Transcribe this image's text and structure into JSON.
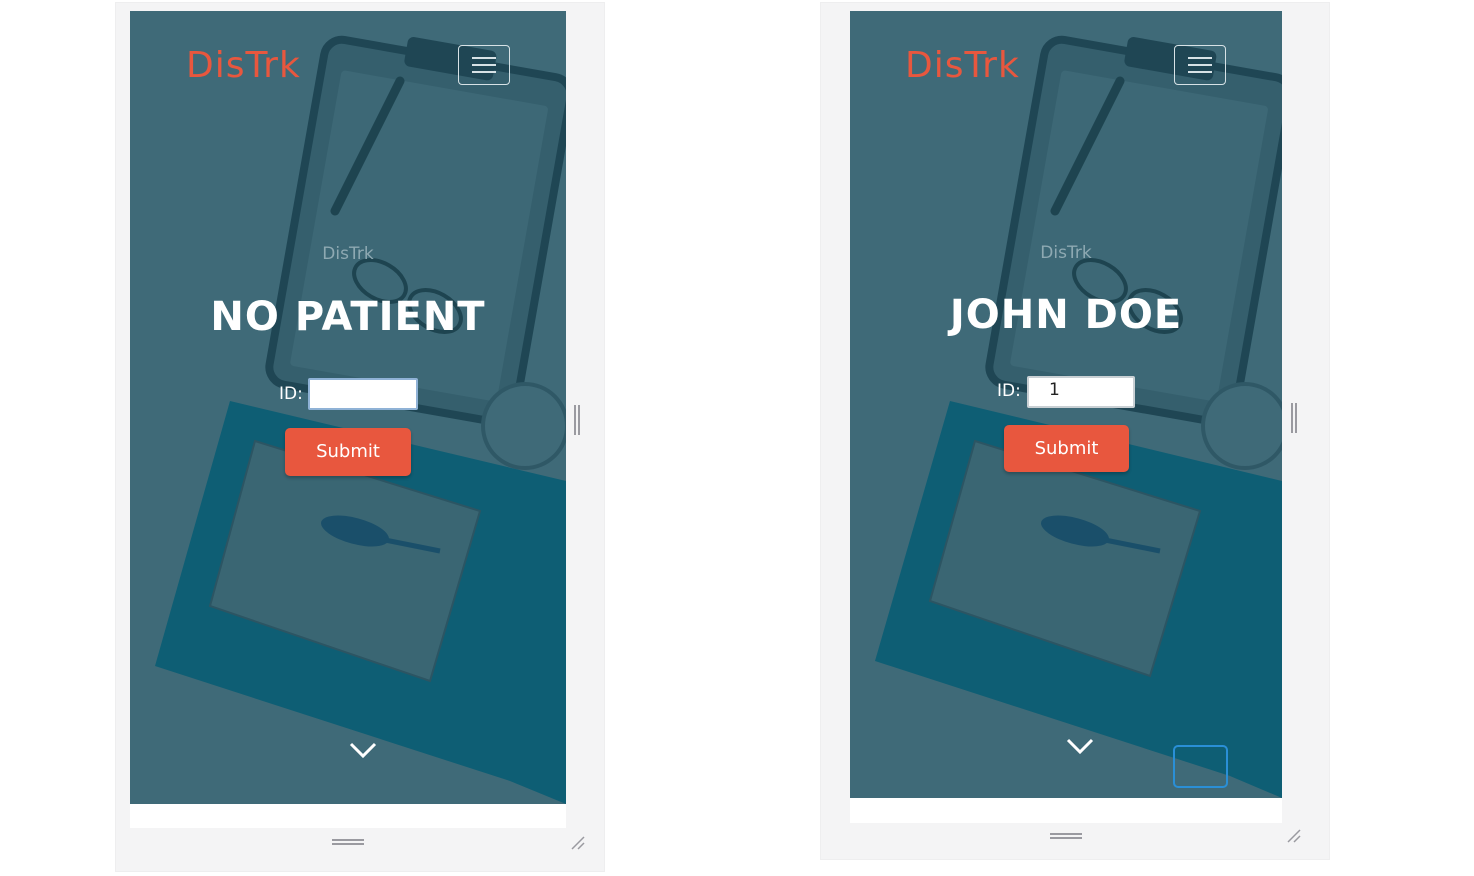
{
  "panels": [
    {
      "brand": "DisTrk",
      "sub_brand": "DisTrk",
      "headline": "NO PATIENT",
      "id_label": "ID:",
      "id_value": "",
      "submit_label": "Submit"
    },
    {
      "brand": "DisTrk",
      "sub_brand": "DisTrk",
      "headline": "JOHN DOE",
      "id_label": "ID:",
      "id_value": "1",
      "submit_label": "Submit"
    }
  ],
  "colors": {
    "accent": "#e8573e",
    "overlay": "#3f6a78",
    "focus": "#2a8fd6"
  },
  "icons": [
    "hamburger-menu-icon",
    "chevron-down-icon",
    "drag-handle-icon",
    "resize-grip-icon",
    "splitter-icon"
  ]
}
